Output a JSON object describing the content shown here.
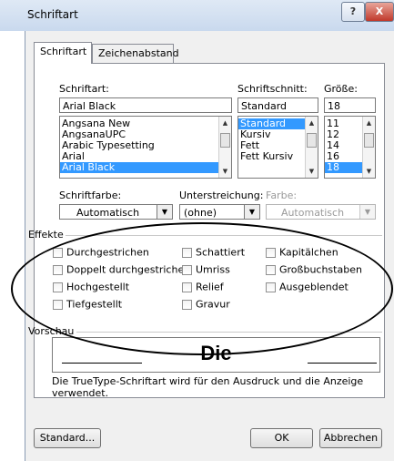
{
  "window": {
    "title": "Schriftart",
    "help_label": "?",
    "close_label": "X"
  },
  "tabs": [
    {
      "label": "Schriftart"
    },
    {
      "label": "Zeichenabstand"
    }
  ],
  "font": {
    "label": "Schriftart:",
    "value": "Arial Black",
    "items": [
      "Angsana New",
      "AngsanaUPC",
      "Arabic Typesetting",
      "Arial",
      "Arial Black"
    ]
  },
  "style": {
    "label": "Schriftschnitt:",
    "value": "Standard",
    "items": [
      "Standard",
      "Kursiv",
      "Fett",
      "Fett Kursiv"
    ]
  },
  "size": {
    "label": "Größe:",
    "value": "18",
    "items": [
      "11",
      "12",
      "14",
      "16",
      "18"
    ]
  },
  "font_color": {
    "label": "Schriftfarbe:",
    "value": "Automatisch"
  },
  "underline": {
    "label": "Unterstreichung:",
    "value": "(ohne)"
  },
  "underline_color": {
    "label": "Farbe:",
    "value": "Automatisch"
  },
  "effects": {
    "label": "Effekte",
    "items": [
      {
        "label": "Durchgestrichen",
        "checked": false
      },
      {
        "label": "Schattiert",
        "checked": false
      },
      {
        "label": "Kapitälchen",
        "checked": false
      },
      {
        "label": "Doppelt durchgestrichen",
        "checked": false
      },
      {
        "label": "Umriss",
        "checked": false
      },
      {
        "label": "Großbuchstaben",
        "checked": false
      },
      {
        "label": "Hochgestellt",
        "checked": false
      },
      {
        "label": "Relief",
        "checked": false
      },
      {
        "label": "Ausgeblendet",
        "checked": false
      },
      {
        "label": "Tiefgestellt",
        "checked": false
      },
      {
        "label": "Gravur",
        "checked": false
      }
    ]
  },
  "preview": {
    "label": "Vorschau",
    "sample": "Die",
    "note": "Die TrueType-Schriftart wird für den Ausdruck und die Anzeige verwendet."
  },
  "buttons": {
    "default_label": "Standard...",
    "ok_label": "OK",
    "cancel_label": "Abbrechen"
  },
  "colors": {
    "selection": "#3399ff",
    "dialog_bg": "#f0f0f0",
    "annotation": "#000000"
  }
}
